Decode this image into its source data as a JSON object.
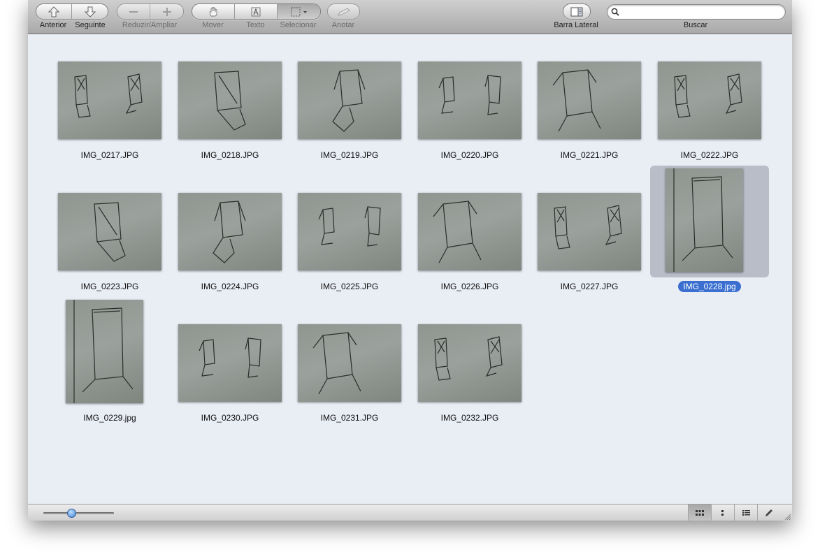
{
  "toolbar": {
    "back_label": "Anterior",
    "forward_label": "Seguinte",
    "zoom_label": "Reduzir/Ampliar",
    "move_label": "Mover",
    "text_label": "Texto",
    "select_label": "Selecionar",
    "annotate_label": "Anotar",
    "sidebar_label": "Barra Lateral",
    "search_label": "Buscar",
    "search_value": ""
  },
  "images": [
    {
      "name": "IMG_0217.JPG",
      "orientation": "landscape",
      "selected": false
    },
    {
      "name": "IMG_0218.JPG",
      "orientation": "landscape",
      "selected": false
    },
    {
      "name": "IMG_0219.JPG",
      "orientation": "landscape",
      "selected": false
    },
    {
      "name": "IMG_0220.JPG",
      "orientation": "landscape",
      "selected": false
    },
    {
      "name": "IMG_0221.JPG",
      "orientation": "landscape",
      "selected": false
    },
    {
      "name": "IMG_0222.JPG",
      "orientation": "landscape",
      "selected": false
    },
    {
      "name": "IMG_0223.JPG",
      "orientation": "landscape",
      "selected": false
    },
    {
      "name": "IMG_0224.JPG",
      "orientation": "landscape",
      "selected": false
    },
    {
      "name": "IMG_0225.JPG",
      "orientation": "landscape",
      "selected": false
    },
    {
      "name": "IMG_0226.JPG",
      "orientation": "landscape",
      "selected": false
    },
    {
      "name": "IMG_0227.JPG",
      "orientation": "landscape",
      "selected": false
    },
    {
      "name": "IMG_0228.jpg",
      "orientation": "portrait",
      "selected": true
    },
    {
      "name": "IMG_0229.jpg",
      "orientation": "portrait",
      "selected": false
    },
    {
      "name": "IMG_0230.JPG",
      "orientation": "landscape",
      "selected": false
    },
    {
      "name": "IMG_0231.JPG",
      "orientation": "landscape",
      "selected": false
    },
    {
      "name": "IMG_0232.JPG",
      "orientation": "landscape",
      "selected": false
    }
  ],
  "bottombar": {
    "thumbnail_size": 0.4,
    "active_view": "grid"
  },
  "colors": {
    "selection": "#3a6fd0",
    "background": "#e9edf4",
    "accent": "#3a7fd5"
  }
}
